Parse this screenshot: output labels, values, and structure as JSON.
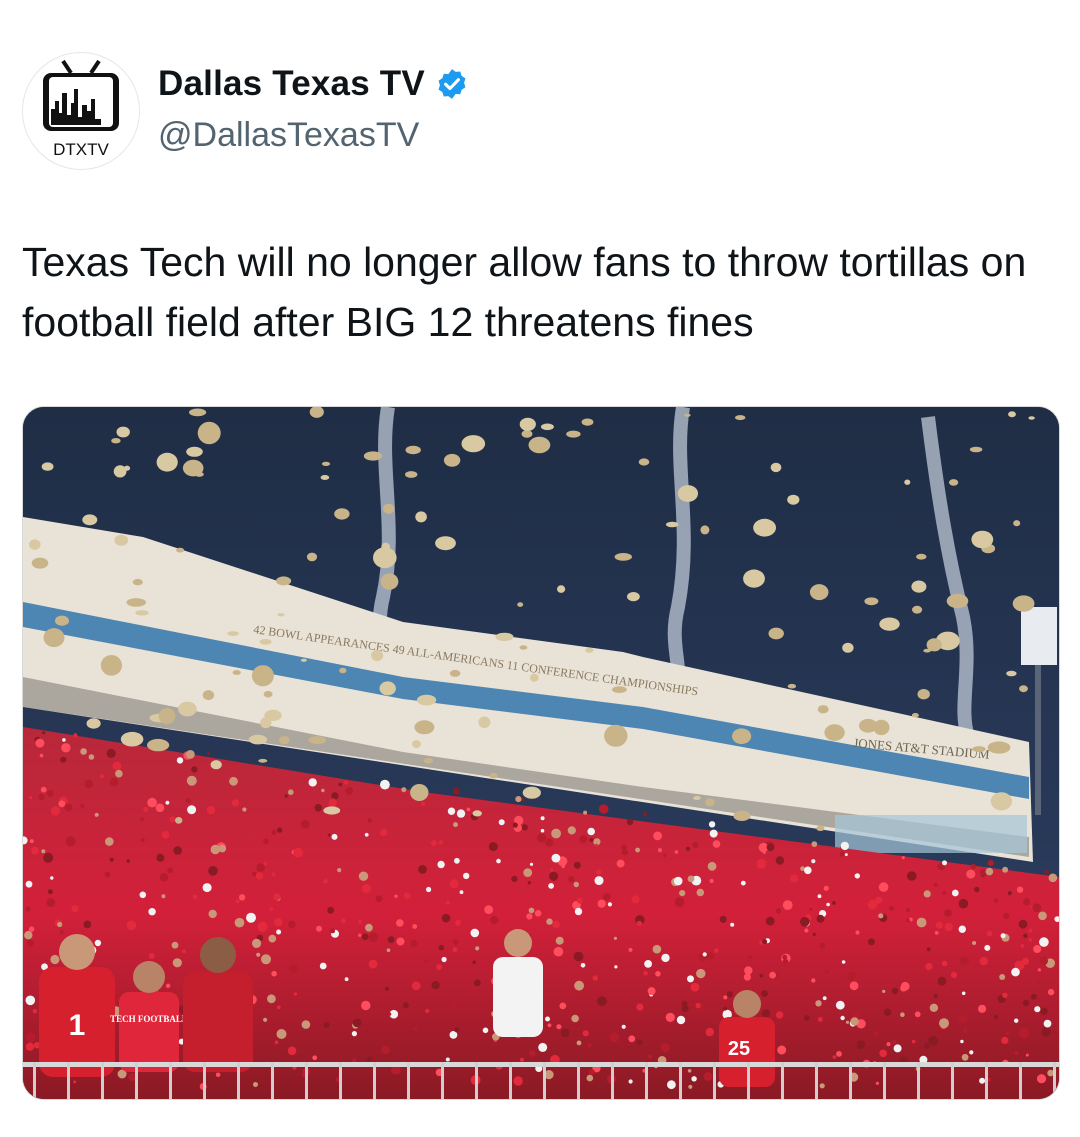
{
  "account": {
    "display_name": "Dallas Texas TV",
    "handle": "@DallasTexasTV",
    "verified": true,
    "verified_color": "#1d9bf0",
    "avatar_text": "DTXTV"
  },
  "tweet": {
    "text": "Texas Tech will no longer allow fans to throw tortillas on football field after BIG 12 threatens fines"
  },
  "media": {
    "stadium_banner": "42 BOWL APPEARANCES  49 ALL-AMERICANS  11 CONFERENCE CHAMPIONSHIPS",
    "stadium_sign": "JONES AT&T STADIUM",
    "jersey_number_1": "1",
    "jersey_number_2": "25",
    "shirt_text": "TECH FOOTBALL"
  },
  "colors": {
    "sky": "#25344f",
    "crowd_red": "#d3203a",
    "tortilla": "#d9c9a3",
    "stadium": "#e9e2d6"
  }
}
